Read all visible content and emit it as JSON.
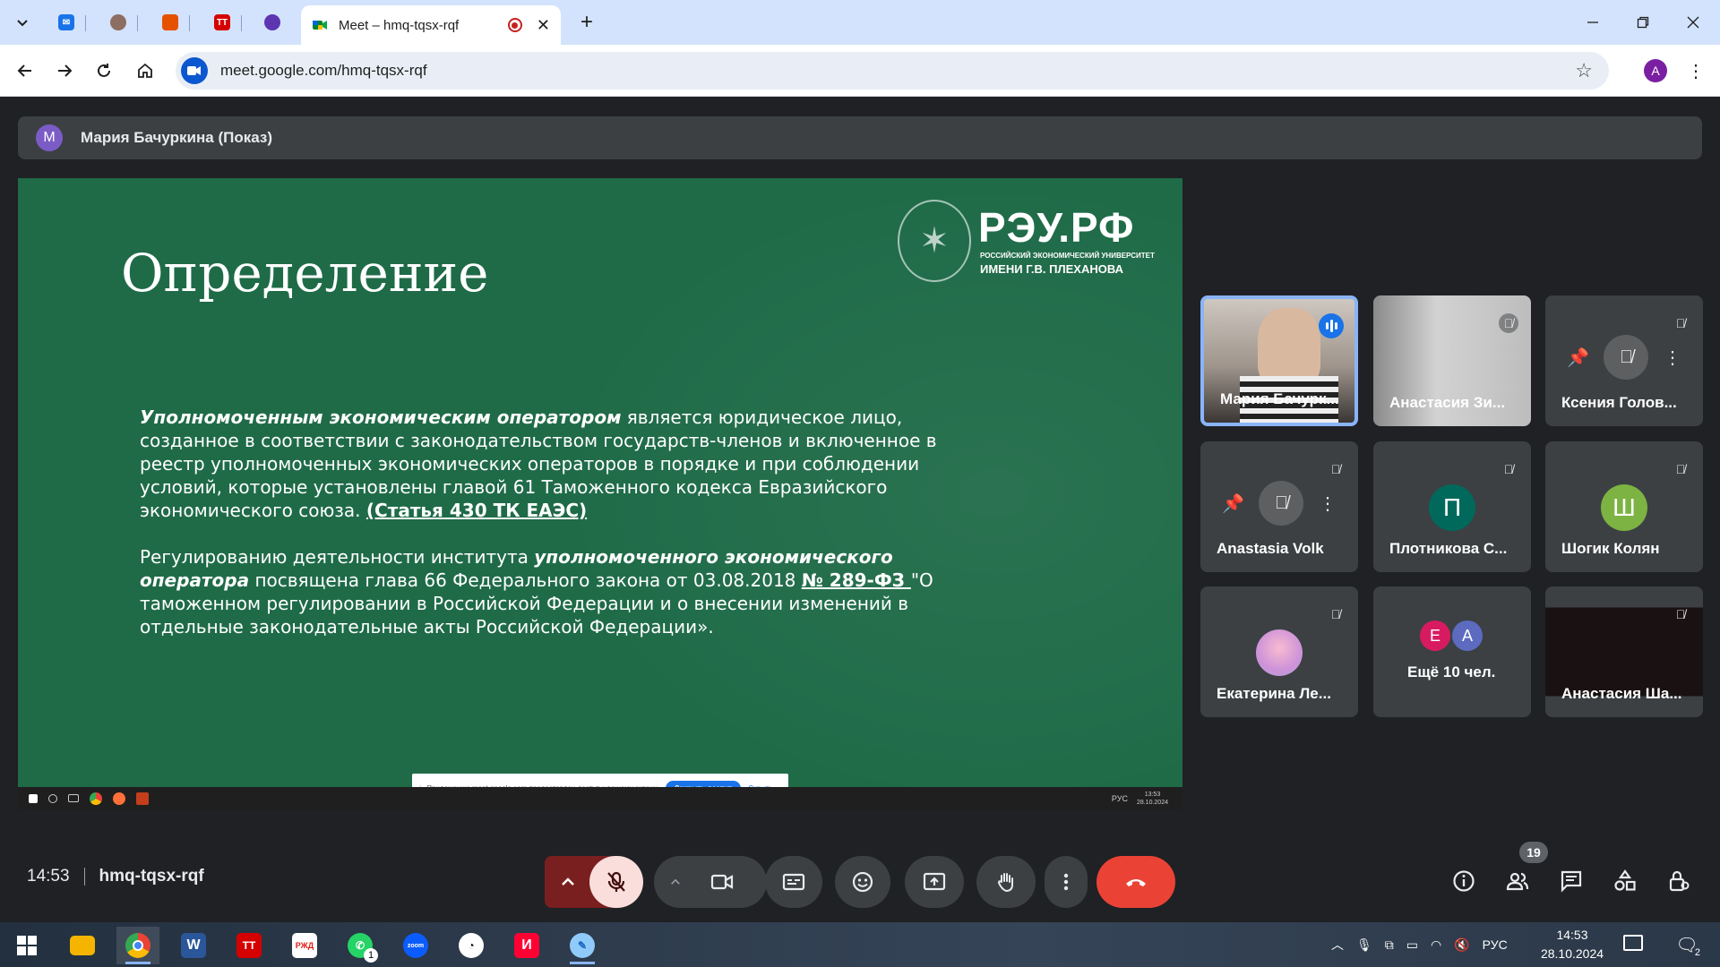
{
  "browser": {
    "active_tab_title": "Meet – hmq-tqsx-rqf",
    "pinned_tabs": [
      {
        "icon": "mail-icon",
        "color": "#1a73e8"
      },
      {
        "icon": "avatar-icon",
        "color": "#8d6e63"
      },
      {
        "icon": "document-icon",
        "color": "#e65100"
      },
      {
        "icon": "tt-icon",
        "label": "TT",
        "color": "#d50000"
      },
      {
        "icon": "app-icon",
        "color": "#5e35b1"
      }
    ],
    "url": "meet.google.com/hmq-tqsx-rqf",
    "profile_initial": "A"
  },
  "meet": {
    "presenter": {
      "initial": "M",
      "label": "Мария Бачуркина (Показ)"
    },
    "slide": {
      "title": "Определение",
      "logo": {
        "big": "РЭУ.РФ",
        "line1": "РОССИЙСКИЙ ЭКОНОМИЧЕСКИЙ УНИВЕРСИТЕТ",
        "line2": "ИМЕНИ Г.В. ПЛЕХАНОВА"
      },
      "p1_em": "Уполномоченным экономическим оператором",
      "p1_text": " является юридическое лицо, созданное в соответствии с законодательством государств-членов и включенное в реестр уполномоченных экономических операторов в порядке и при соблюдении условий, которые установлены главой 61 Таможенного кодекса Евразийского экономического союза. ",
      "p1_link": "(Статья 430 ТК ЕАЭС)",
      "p2_a": "Регулированию деятельности института ",
      "p2_em": "уполномоченного экономического оператора",
      "p2_b": " посвящена глава 66 Федерального закона от 03.08.2018 ",
      "p2_link": "№ 289-ФЗ ",
      "p2_c": "\"О таможенном регулировании в Российской Федерации и о внесении изменений в отдельные законодательные акты Российской Федерации»."
    },
    "share_notice": {
      "text": "Приложению meet.google.com предоставлен доступ к вашему экрану.",
      "stop": "Закрыть доступ",
      "hide": "Скрыть"
    },
    "inner_taskbar": {
      "lang": "РУС",
      "time": "13:53",
      "date": "28.10.2024"
    },
    "participants": [
      {
        "name": "Мария Бачурк...",
        "speaking": true
      },
      {
        "name": "Анастасия Зи...",
        "muted": true
      },
      {
        "name": "Ксения Голов...",
        "muted": true
      },
      {
        "name": "Anastasia Volk",
        "muted": true
      },
      {
        "name": "Плотникова С...",
        "initial": "П",
        "color": "#00695c",
        "muted": true
      },
      {
        "name": "Шогик Колян",
        "initial": "Ш",
        "color": "#7cb342",
        "muted": true
      },
      {
        "name": "Екатерина Ле...",
        "muted": true
      },
      {
        "name": "Ещё 10 чел.",
        "initials": [
          "Е",
          "А"
        ],
        "colors": [
          "#d81b60",
          "#5c6bc0"
        ]
      },
      {
        "name": "Анастасия Ша...",
        "muted": true
      }
    ],
    "time": "14:53",
    "meeting_code": "hmq-tqsx-rqf",
    "people_count": "19",
    "colors": {
      "end_call": "#ea4335",
      "mic_off": "#f9dedc",
      "accent": "#8ab4f8"
    }
  },
  "taskbar": {
    "apps": [
      {
        "icon": "windows-icon"
      },
      {
        "icon": "file-explorer-icon",
        "color": "#f4b400"
      },
      {
        "icon": "chrome-icon",
        "open": true
      },
      {
        "icon": "word-icon",
        "label": "W",
        "color": "#2b579a"
      },
      {
        "icon": "tt-icon",
        "label": "TT",
        "color": "#d50000"
      },
      {
        "icon": "rzd-icon",
        "label": "РЖД",
        "color": "#ffffff"
      },
      {
        "icon": "whatsapp-icon",
        "color": "#25d366",
        "badge": "1"
      },
      {
        "icon": "zoom-icon",
        "label": "zoom",
        "color": "#0b5cff"
      },
      {
        "icon": "clock-app-icon",
        "color": "#ffffff"
      },
      {
        "icon": "yandex-icon",
        "label": "И",
        "color": "#ff0033"
      },
      {
        "icon": "paint-icon",
        "color": "#90caf9"
      }
    ],
    "lang": "РУС",
    "time": "14:53",
    "date": "28.10.2024",
    "notification_count": "2"
  }
}
